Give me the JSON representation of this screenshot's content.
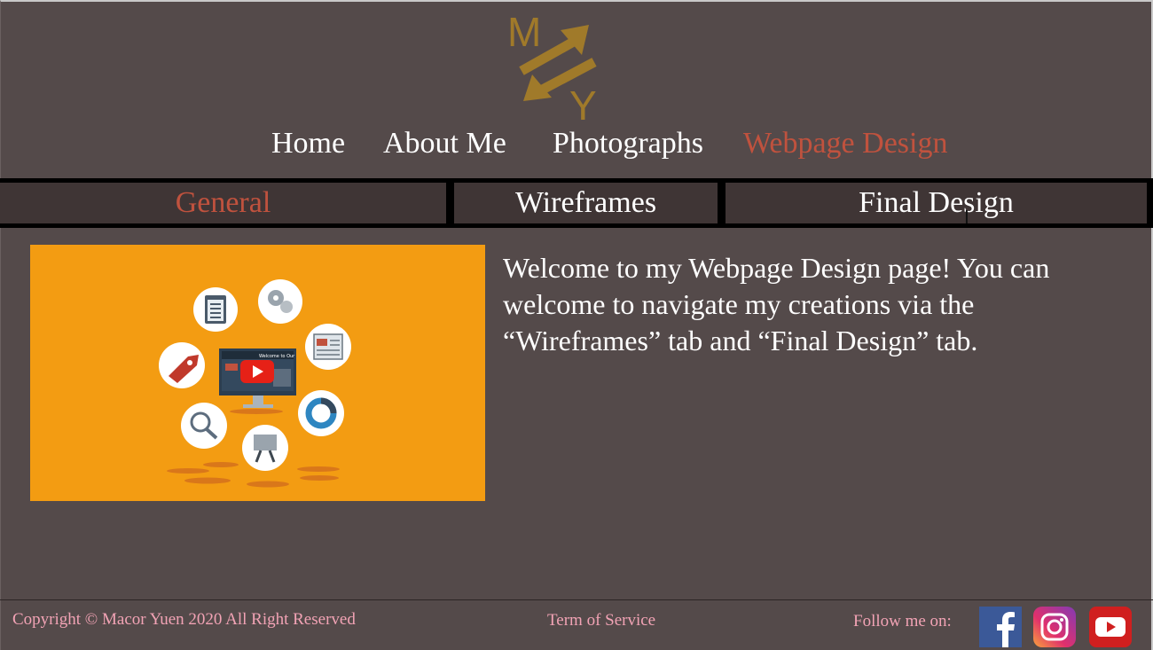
{
  "logo": {
    "letters": [
      "M",
      "Y"
    ],
    "color": "#a07a2a"
  },
  "nav": {
    "items": [
      {
        "label": "Home"
      },
      {
        "label": "About Me"
      },
      {
        "label": "Photographs"
      },
      {
        "label": "Webpage Design",
        "active": true
      }
    ]
  },
  "tabs": [
    {
      "label": "General",
      "active": true
    },
    {
      "label": "Wireframes"
    },
    {
      "label": "Final Design"
    }
  ],
  "video": {
    "background": "#f39c12",
    "screen_title": "Welcome to Our",
    "play_icon": "youtube-play-icon"
  },
  "intro_text": "Welcome to my Webpage Design page! You can welcome to navigate my creations via the “Wireframes” tab and “Final Design” tab.",
  "footer": {
    "copyright": "Copyright ©  Macor Yuen 2020 All Right Reserved",
    "terms": "Term of Service",
    "follow": "Follow me on:",
    "social": [
      "facebook-icon",
      "instagram-icon",
      "youtube-icon"
    ]
  },
  "colors": {
    "background": "#544a4a",
    "accent": "#c0523e",
    "tab_bg": "#3f3535",
    "footer_text": "#f2a3b5"
  }
}
